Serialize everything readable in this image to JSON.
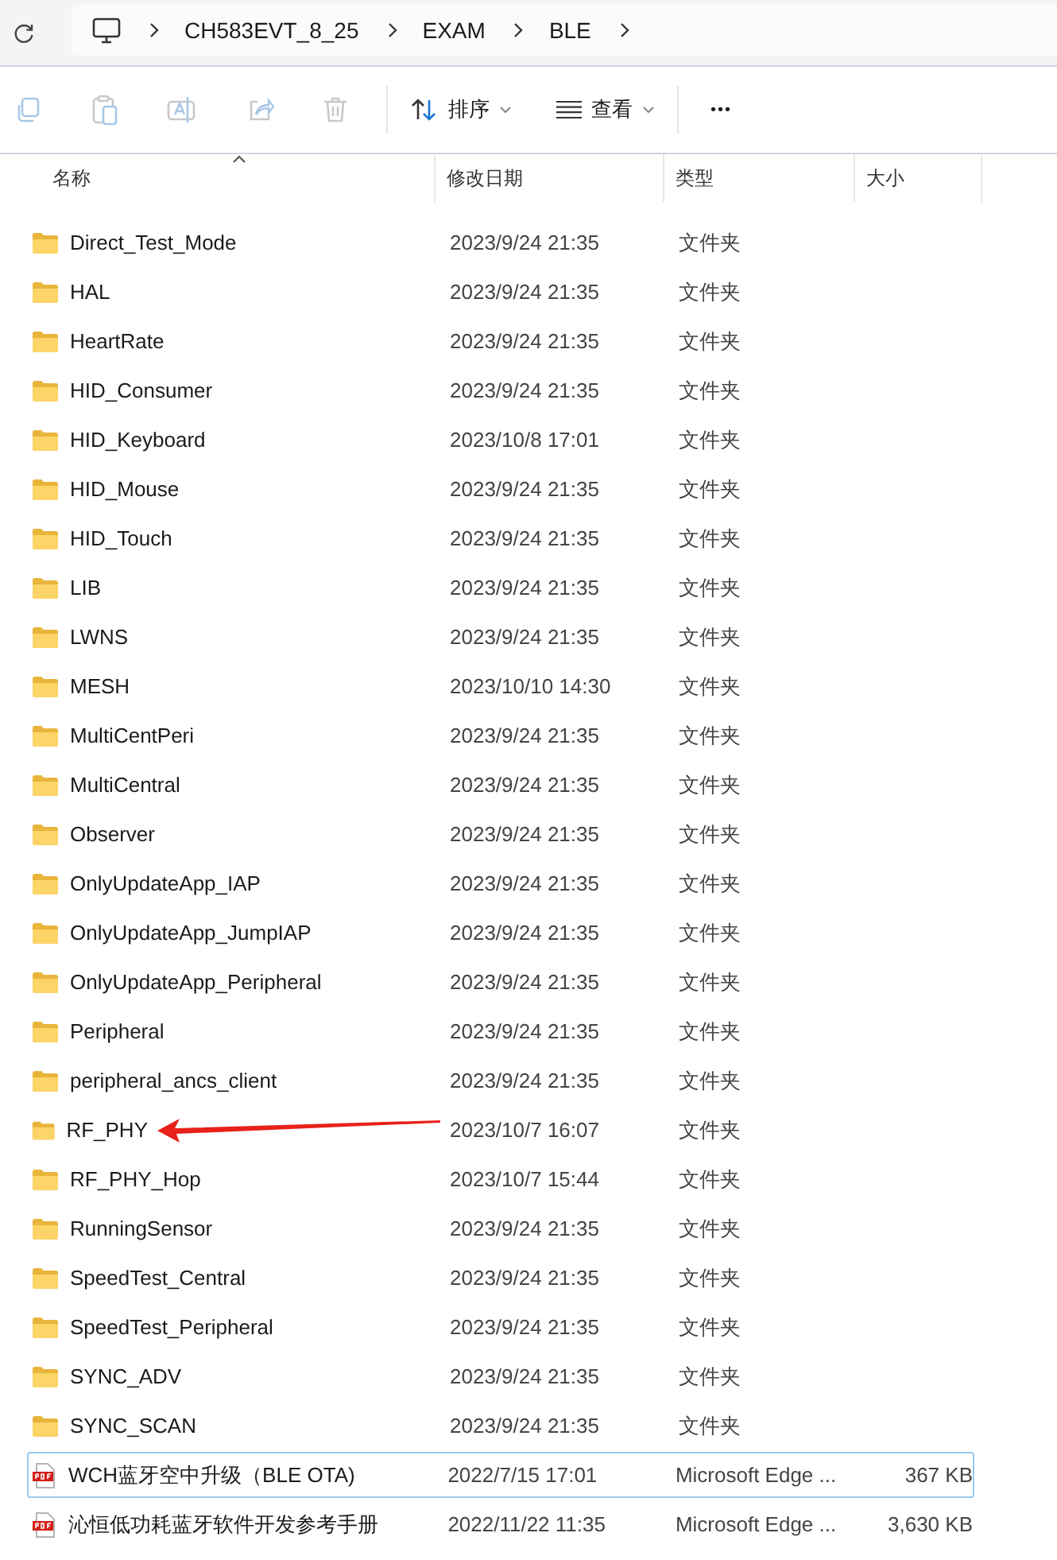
{
  "breadcrumb": [
    "CH583EVT_8_25",
    "EXAM",
    "BLE"
  ],
  "toolbar": {
    "sort": "排序",
    "view": "查看",
    "more": "•••"
  },
  "columns": [
    "名称",
    "修改日期",
    "类型",
    "大小"
  ],
  "rows": [
    {
      "kind": "folder",
      "name": "Direct_Test_Mode",
      "date": "2023/9/24 21:35",
      "type": "文件夹",
      "selected": false,
      "marked": false
    },
    {
      "kind": "folder",
      "name": "HAL",
      "date": "2023/9/24 21:35",
      "type": "文件夹",
      "selected": false,
      "marked": false
    },
    {
      "kind": "folder",
      "name": "HeartRate",
      "date": "2023/9/24 21:35",
      "type": "文件夹",
      "selected": false,
      "marked": false
    },
    {
      "kind": "folder",
      "name": "HID_Consumer",
      "date": "2023/9/24 21:35",
      "type": "文件夹",
      "selected": false,
      "marked": false
    },
    {
      "kind": "folder",
      "name": "HID_Keyboard",
      "date": "2023/10/8 17:01",
      "type": "文件夹",
      "selected": false,
      "marked": false
    },
    {
      "kind": "folder",
      "name": "HID_Mouse",
      "date": "2023/9/24 21:35",
      "type": "文件夹",
      "selected": false,
      "marked": false
    },
    {
      "kind": "folder",
      "name": "HID_Touch",
      "date": "2023/9/24 21:35",
      "type": "文件夹",
      "selected": false,
      "marked": false
    },
    {
      "kind": "folder",
      "name": "LIB",
      "date": "2023/9/24 21:35",
      "type": "文件夹",
      "selected": false,
      "marked": false
    },
    {
      "kind": "folder",
      "name": "LWNS",
      "date": "2023/9/24 21:35",
      "type": "文件夹",
      "selected": false,
      "marked": false
    },
    {
      "kind": "folder",
      "name": "MESH",
      "date": "2023/10/10 14:30",
      "type": "文件夹",
      "selected": false,
      "marked": false
    },
    {
      "kind": "folder",
      "name": "MultiCentPeri",
      "date": "2023/9/24 21:35",
      "type": "文件夹",
      "selected": false,
      "marked": false
    },
    {
      "kind": "folder",
      "name": "MultiCentral",
      "date": "2023/9/24 21:35",
      "type": "文件夹",
      "selected": false,
      "marked": false
    },
    {
      "kind": "folder",
      "name": "Observer",
      "date": "2023/9/24 21:35",
      "type": "文件夹",
      "selected": false,
      "marked": false
    },
    {
      "kind": "folder",
      "name": "OnlyUpdateApp_IAP",
      "date": "2023/9/24 21:35",
      "type": "文件夹",
      "selected": false,
      "marked": false
    },
    {
      "kind": "folder",
      "name": "OnlyUpdateApp_JumpIAP",
      "date": "2023/9/24 21:35",
      "type": "文件夹",
      "selected": false,
      "marked": false
    },
    {
      "kind": "folder",
      "name": "OnlyUpdateApp_Peripheral",
      "date": "2023/9/24 21:35",
      "type": "文件夹",
      "selected": false,
      "marked": false
    },
    {
      "kind": "folder",
      "name": "Peripheral",
      "date": "2023/9/24 21:35",
      "type": "文件夹",
      "selected": false,
      "marked": false
    },
    {
      "kind": "folder",
      "name": "peripheral_ancs_client",
      "date": "2023/9/24 21:35",
      "type": "文件夹",
      "selected": false,
      "marked": false
    },
    {
      "kind": "folder",
      "name": "RF_PHY",
      "date": "2023/10/7 16:07",
      "type": "文件夹",
      "selected": false,
      "marked": true
    },
    {
      "kind": "folder",
      "name": "RF_PHY_Hop",
      "date": "2023/10/7 15:44",
      "type": "文件夹",
      "selected": false,
      "marked": false
    },
    {
      "kind": "folder",
      "name": "RunningSensor",
      "date": "2023/9/24 21:35",
      "type": "文件夹",
      "selected": false,
      "marked": false
    },
    {
      "kind": "folder",
      "name": "SpeedTest_Central",
      "date": "2023/9/24 21:35",
      "type": "文件夹",
      "selected": false,
      "marked": false
    },
    {
      "kind": "folder",
      "name": "SpeedTest_Peripheral",
      "date": "2023/9/24 21:35",
      "type": "文件夹",
      "selected": false,
      "marked": false
    },
    {
      "kind": "folder",
      "name": "SYNC_ADV",
      "date": "2023/9/24 21:35",
      "type": "文件夹",
      "selected": false,
      "marked": false
    },
    {
      "kind": "folder",
      "name": "SYNC_SCAN",
      "date": "2023/9/24 21:35",
      "type": "文件夹",
      "selected": false,
      "marked": false
    },
    {
      "kind": "pdf",
      "name": "WCH蓝牙空中升级（BLE OTA)",
      "date": "2022/7/15 17:01",
      "type": "Microsoft Edge ...",
      "size": "367 KB",
      "selected": true,
      "marked": false
    },
    {
      "kind": "pdf",
      "name": "沁恒低功耗蓝牙软件开发参考手册",
      "date": "2022/11/22 11:35",
      "type": "Microsoft Edge ...",
      "size": "3,630 KB",
      "selected": false,
      "marked": false
    }
  ]
}
